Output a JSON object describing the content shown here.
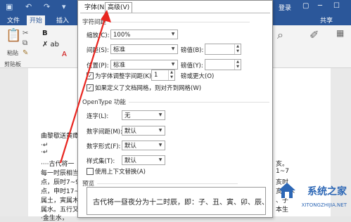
{
  "word": {
    "title_right": "登录",
    "ribbon_tabs": [
      "文件",
      "开始",
      "插入"
    ],
    "share_label": "共享",
    "clipboard_group": "剪贴板",
    "paste_label": "粘贴"
  },
  "document": {
    "lines": [
      "曲黎歇送黄瘴",
      "·↵",
      "·↵",
      "····古代将一",
      "每一时辰相当",
      "点，辰时7~9",
      "点，申时17~19 点",
      "属土，寅属木",
      "属水。五行又",
      "·金生水，"
    ],
    "right_lines": [
      "亥。",
      "1~7",
      "亥时",
      "亥属水",
      "、子",
      "本生"
    ]
  },
  "dialog": {
    "tabs": [
      "字体(N)",
      "高级(V)"
    ],
    "spacing_section": "字符间距",
    "scale_label": "缩放(C):",
    "scale_value": "100%",
    "spacing_label": "间距(S):",
    "spacing_value": "标准",
    "spacing_by_label": "磅值(B):",
    "position_label": "位置(P):",
    "position_value": "标准",
    "position_by_label": "磅值(Y):",
    "kerning_label": "为字体调整字间距(K):",
    "kerning_value": "1",
    "kerning_suffix": "磅或更大(O)",
    "grid_label": "如果定义了文档网格，则对齐到网格(W)",
    "opentype_section": "OpenType 功能",
    "ligatures_label": "连字(L):",
    "ligatures_value": "无",
    "num_spacing_label": "数字间距(M):",
    "num_spacing_value": "默认",
    "num_forms_label": "数字形式(F):",
    "num_forms_value": "默认",
    "stylistic_label": "样式集(T):",
    "stylistic_value": "默认",
    "contextual_label": "使用上下文替换(A)",
    "preview_section": "预览",
    "preview_text": "古代将一昼夜分为十二时辰，即：子、丑、寅、卯、辰、"
  },
  "watermark": {
    "name": "系统之家",
    "url": "XITONGZHIJIA.NET"
  },
  "colors": {
    "word_blue": "#2b579a",
    "arrow_red": "#e8251f",
    "watermark_blue": "#2d67b5"
  }
}
